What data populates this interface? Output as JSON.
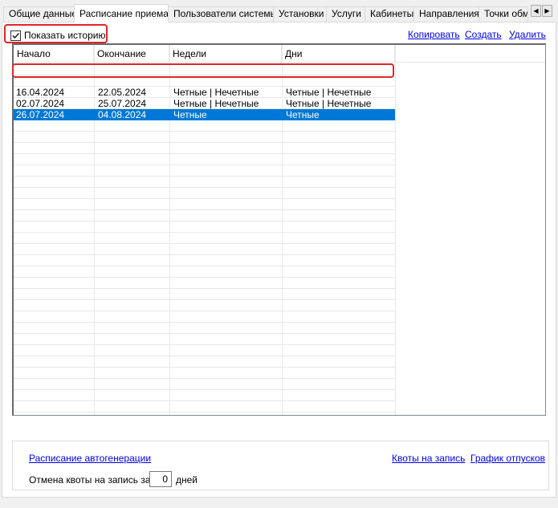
{
  "tabs": [
    {
      "label": "Общие данные"
    },
    {
      "label": "Расписание приема"
    },
    {
      "label": "Пользователи системы"
    },
    {
      "label": "Установки"
    },
    {
      "label": "Услуги"
    },
    {
      "label": "Кабинеты"
    },
    {
      "label": "Направления"
    },
    {
      "label": "Точки обмена"
    }
  ],
  "toolbar": {
    "show_history_label": "Показать историю",
    "show_history_checked": true,
    "copy_label": "Копировать",
    "create_label": "Создать",
    "delete_label": "Удалить"
  },
  "table": {
    "columns": [
      "Начало",
      "Окончание",
      "Недели",
      "Дни"
    ],
    "rows": [
      [
        "16.04.2024",
        "22.05.2024",
        "Четные | Нечетные",
        "Четные | Нечетные"
      ],
      [
        "02.07.2024",
        "25.07.2024",
        "Четные | Нечетные",
        "Четные | Нечетные"
      ],
      [
        "26.07.2024",
        "04.08.2024",
        "Четные",
        "Четные"
      ]
    ],
    "selected_row": 2
  },
  "bottom": {
    "autogen_link": "Расписание автогенерации",
    "quota_link": "Квоты на запись",
    "vacation_link": "График отпусков",
    "cancel_quota_label": "Отмена квоты на запись за",
    "cancel_quota_value": "0",
    "days_label": "дней"
  },
  "colors": {
    "selection": "#0078d7",
    "highlight": "#e0262b",
    "link": "#0000ee"
  }
}
